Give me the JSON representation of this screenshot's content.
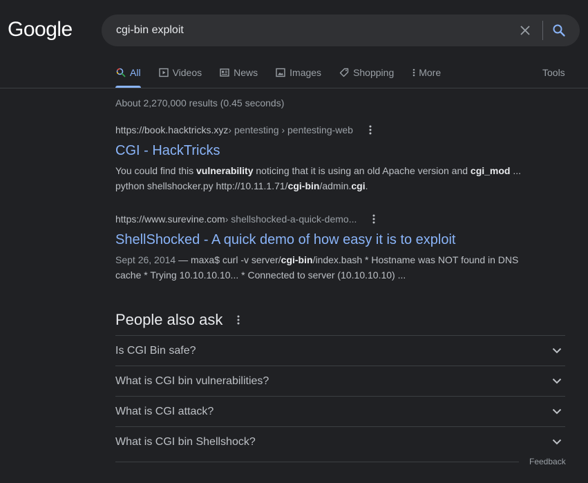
{
  "logo": "Google",
  "search": {
    "query": "cgi-bin exploit"
  },
  "tabs": [
    {
      "label": "All",
      "icon": "search-icon",
      "active": true
    },
    {
      "label": "Videos",
      "icon": "play-icon",
      "active": false
    },
    {
      "label": "News",
      "icon": "newspaper-icon",
      "active": false
    },
    {
      "label": "Images",
      "icon": "image-icon",
      "active": false
    },
    {
      "label": "Shopping",
      "icon": "tag-icon",
      "active": false
    },
    {
      "label": "More",
      "icon": "kebab-icon",
      "active": false
    }
  ],
  "tools_label": "Tools",
  "result_stats": "About 2,270,000 results (0.45 seconds)",
  "results": [
    {
      "site": "https://book.hacktricks.xyz",
      "path": " › pentesting › pentesting-web",
      "title": "CGI - HackTricks",
      "snippet_parts": [
        {
          "t": "You could find this ",
          "b": false
        },
        {
          "t": "vulnerability",
          "b": true
        },
        {
          "t": " noticing that it is using an old Apache version and ",
          "b": false
        },
        {
          "t": "cgi_mod",
          "b": true
        },
        {
          "t": " ... python shellshocker.py http://10.11.1.71/",
          "b": false
        },
        {
          "t": "cgi-bin",
          "b": true
        },
        {
          "t": "/admin.",
          "b": false
        },
        {
          "t": "cgi",
          "b": true
        },
        {
          "t": ".",
          "b": false
        }
      ]
    },
    {
      "site": "https://www.surevine.com",
      "path": " › shellshocked-a-quick-demo...",
      "title": "ShellShocked - A quick demo of how easy it is to exploit",
      "date": "Sept 26, 2014",
      "snippet_parts": [
        {
          "t": " — maxa$ curl -v server/",
          "b": false
        },
        {
          "t": "cgi-bin",
          "b": true
        },
        {
          "t": "/index.bash * Hostname was NOT found in DNS cache * Trying 10.10.10.10... * Connected to server (10.10.10.10) ...",
          "b": false
        }
      ]
    }
  ],
  "people_also_ask": {
    "heading": "People also ask",
    "questions": [
      "Is CGI Bin safe?",
      "What is CGI bin vulnerabilities?",
      "What is CGI attack?",
      "What is CGI bin Shellshock?"
    ]
  },
  "feedback_label": "Feedback",
  "colors": {
    "background": "#202124",
    "link": "#8ab4f8",
    "text": "#bdc1c6",
    "muted": "#9aa0a6",
    "searchbox": "#303134"
  }
}
